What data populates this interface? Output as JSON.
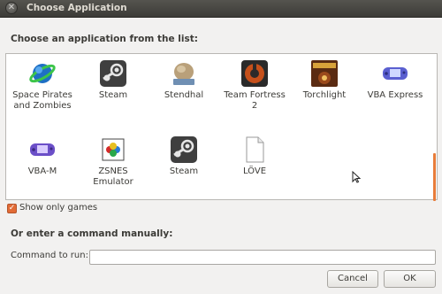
{
  "window": {
    "title": "Choose Application"
  },
  "heading": "Choose an application from the list:",
  "apps": [
    {
      "label": "Space Pirates and Zombies",
      "icon": "spaz-planet-icon"
    },
    {
      "label": "Steam",
      "icon": "steam-icon"
    },
    {
      "label": "Stendhal",
      "icon": "stendhal-icon"
    },
    {
      "label": "Team Fortress 2",
      "icon": "tf2-icon"
    },
    {
      "label": "Torchlight",
      "icon": "torchlight-icon"
    },
    {
      "label": "VBA Express",
      "icon": "gameboy-advance-icon"
    },
    {
      "label": "VBA-M",
      "icon": "gameboy-advance-purple-icon"
    },
    {
      "label": "ZSNES Emulator",
      "icon": "zsnes-icon"
    },
    {
      "label": "Steam",
      "icon": "steam-icon"
    },
    {
      "label": "LÖVE",
      "icon": "blank-document-icon"
    }
  ],
  "show_only_games": {
    "label": "Show only games",
    "checked": true
  },
  "manual_section": "Or enter a command manually:",
  "command": {
    "label": "Command to run:",
    "value": "",
    "placeholder": ""
  },
  "buttons": {
    "cancel": "Cancel",
    "ok": "OK"
  },
  "colors": {
    "accent": "#e26b36",
    "titlebar": "#3c3b37"
  }
}
